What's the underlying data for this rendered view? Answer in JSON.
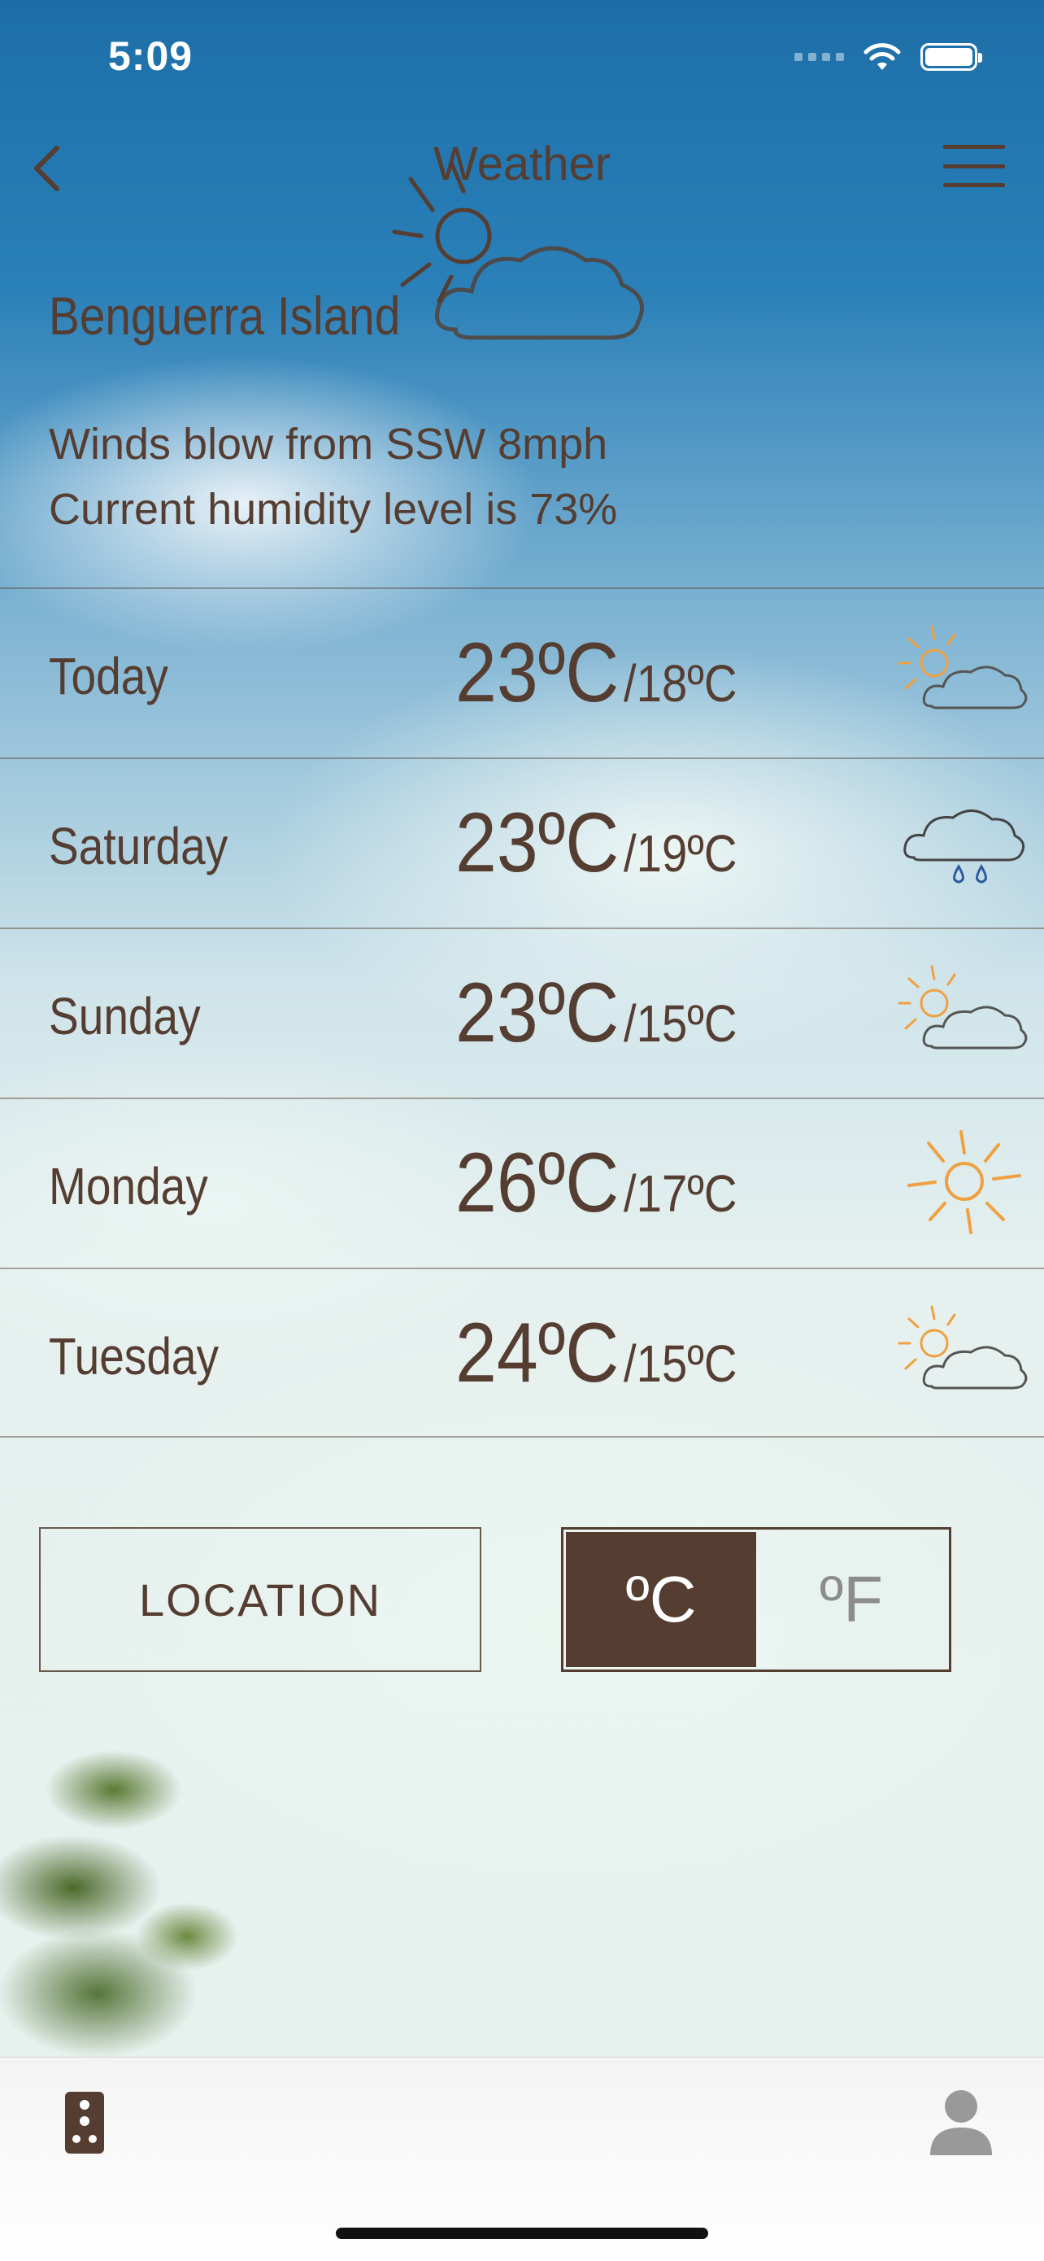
{
  "status_bar": {
    "time": "5:09"
  },
  "nav": {
    "title": "Weather",
    "back_icon": "chevron-left-icon",
    "menu_icon": "hamburger-menu-icon"
  },
  "hero": {
    "icon": "partly-cloudy-icon",
    "location": "Benguerra Island"
  },
  "info": {
    "wind": "Winds blow from SSW 8mph",
    "humidity": "Current humidity level is 73%"
  },
  "forecast": [
    {
      "day": "Today",
      "high": "23ºC",
      "low": "/18ºC",
      "icon": "partly-cloudy-icon"
    },
    {
      "day": "Saturday",
      "high": "23ºC",
      "low": "/19ºC",
      "icon": "rain-cloud-icon"
    },
    {
      "day": "Sunday",
      "high": "23ºC",
      "low": "/15ºC",
      "icon": "partly-cloudy-icon"
    },
    {
      "day": "Monday",
      "high": "26ºC",
      "low": "/17ºC",
      "icon": "sun-icon"
    },
    {
      "day": "Tuesday",
      "high": "24ºC",
      "low": "/15ºC",
      "icon": "partly-cloudy-icon"
    }
  ],
  "controls": {
    "location_label": "LOCATION",
    "unit_c": "ºC",
    "unit_f": "ºF",
    "selected_unit": "C"
  },
  "tabbar": {
    "left_icon": "remote-control-icon",
    "right_icon": "user-profile-icon"
  },
  "colors": {
    "brown": "#553d31",
    "sun_orange": "#f0a040",
    "rain_blue": "#2c5aa0",
    "inactive_gray": "#8c8c8c"
  }
}
